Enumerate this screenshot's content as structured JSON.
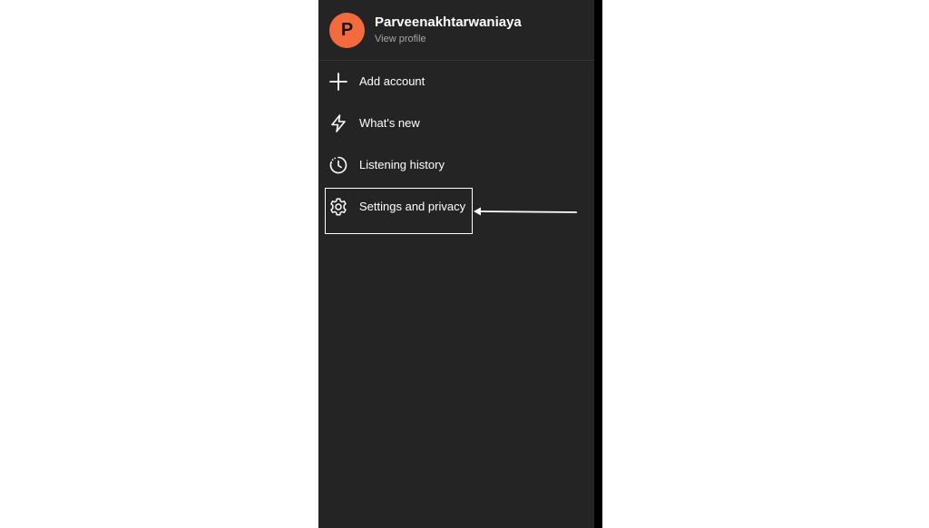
{
  "profile": {
    "avatar_letter": "P",
    "avatar_color": "#f26a3d",
    "name": "Parveenakhtarwaniaya",
    "subtitle": "View profile"
  },
  "menu": {
    "items": [
      {
        "label": "Add account",
        "icon": "plus-icon"
      },
      {
        "label": "What's new",
        "icon": "lightning-bolt-icon"
      },
      {
        "label": "Listening history",
        "icon": "clock-history-icon"
      },
      {
        "label": "Settings and privacy",
        "icon": "gear-icon"
      }
    ],
    "highlighted_item": "Settings and privacy"
  },
  "colors": {
    "drawer_background": "#242424",
    "text_primary": "#ffffff",
    "text_secondary": "#a7a7a7",
    "page_background": "#ffffff"
  }
}
